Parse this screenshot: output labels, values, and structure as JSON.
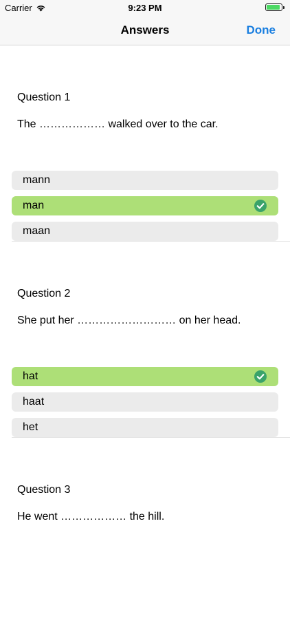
{
  "status_bar": {
    "carrier": "Carrier",
    "time": "9:23 PM",
    "battery_level": 0.9,
    "battery_color": "#4cd964"
  },
  "nav": {
    "title": "Answers",
    "done_label": "Done",
    "accent_color": "#1a7fe0"
  },
  "questions": [
    {
      "label": "Question 1",
      "text": "The ……………… walked over to the car.",
      "options": [
        {
          "label": "mann",
          "correct": false
        },
        {
          "label": "man",
          "correct": true
        },
        {
          "label": "maan",
          "correct": false
        }
      ]
    },
    {
      "label": "Question 2",
      "text": "She put her ……………………… on her head.",
      "options": [
        {
          "label": "hat",
          "correct": true
        },
        {
          "label": "haat",
          "correct": false
        },
        {
          "label": "het",
          "correct": false
        }
      ]
    },
    {
      "label": "Question 3",
      "text": "He went ……………… the hill."
    }
  ],
  "colors": {
    "correct_bg": "#addf77",
    "option_bg": "#ebebeb",
    "check_icon": "#3aa36a"
  }
}
